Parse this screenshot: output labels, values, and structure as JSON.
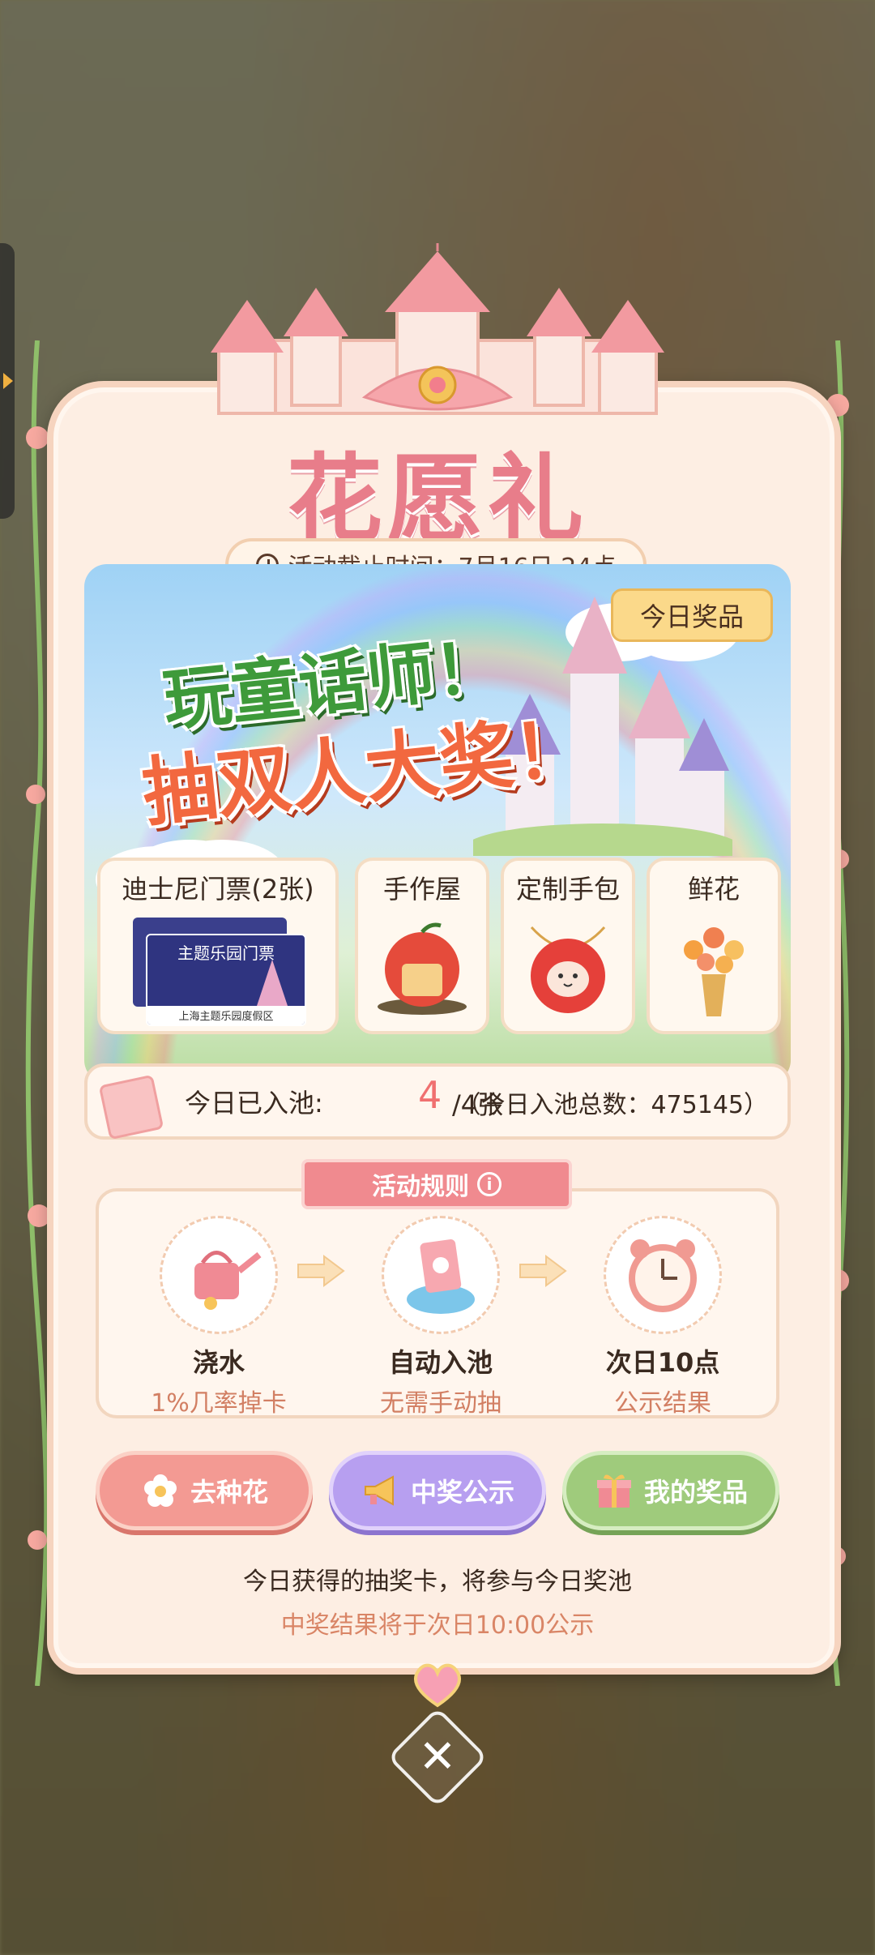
{
  "title": "花愿礼",
  "deadline": "活动截止时间：7月16日 24点",
  "banner": {
    "line1": "玩童话师！",
    "line2": "抽双人大奖！",
    "today_prize_label": "今日奖品"
  },
  "prizes": [
    {
      "name": "迪士尼门票(2张)",
      "ticket_text": "主题乐园门票",
      "ticket_footer": "上海主题乐园度假区"
    },
    {
      "name": "手作屋"
    },
    {
      "name": "定制手包"
    },
    {
      "name": "鲜花"
    }
  ],
  "pool": {
    "label": "今日已入池:",
    "count": "4",
    "unit": "/4张",
    "total": "（今日入池总数：475145）"
  },
  "rules": {
    "title": "活动规则",
    "info_glyph": "i",
    "steps": [
      {
        "title": "浇水",
        "desc": "1%几率掉卡"
      },
      {
        "title": "自动入池",
        "desc": "无需手动抽"
      },
      {
        "title": "次日10点",
        "desc": "公示结果"
      }
    ]
  },
  "actions": {
    "plant": "去种花",
    "notice": "中奖公示",
    "mine": "我的奖品"
  },
  "notes": {
    "line1": "今日获得的抽奖卡，将参与今日奖池",
    "line2": "中奖结果将于次日10:00公示"
  },
  "close_glyph": "✕",
  "colors": {
    "title": "#e87d8a",
    "accent_pink": "#f39a93",
    "accent_purple": "#b79ff0",
    "accent_green": "#9fcb7c",
    "gold": "#fbd98a"
  }
}
